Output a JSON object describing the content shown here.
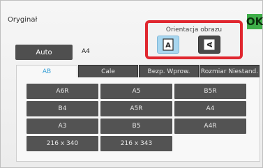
{
  "title": "Oryginał",
  "ok_label": "OK",
  "orientation": {
    "label": "Orientacja obrazu",
    "portrait_icon": "portrait-a-icon",
    "landscape_icon": "landscape-a-icon"
  },
  "auto_label": "Auto",
  "current_size": "A4",
  "tabs": [
    "AB",
    "Cale",
    "Bezp. Wprow.",
    "Rozmiar Niestand."
  ],
  "sizes": [
    "A6R",
    "A5",
    "B5R",
    "B4",
    "A5R",
    "A4",
    "A3",
    "B5",
    "A4R",
    "216 x 340",
    "216 x 343"
  ],
  "colors": {
    "accent": "#39a0d6",
    "ok": "#3fae49",
    "highlight": "#e0272f"
  }
}
